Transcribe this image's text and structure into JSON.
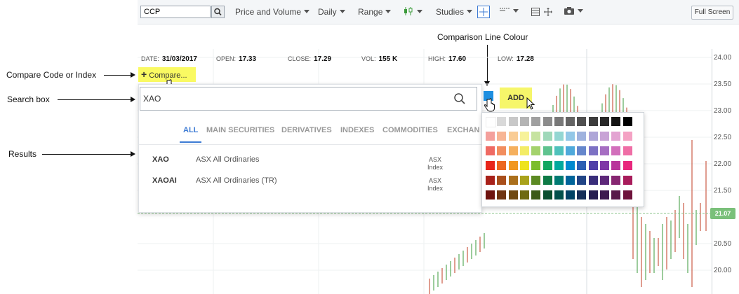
{
  "annotations": {
    "compare": "Compare Code or Index",
    "search": "Search box",
    "results": "Results",
    "colour": "Comparison Line Colour"
  },
  "toolbar": {
    "code_value": "CCP",
    "price_volume": "Price and Volume",
    "interval": "Daily",
    "range": "Range",
    "studies": "Studies",
    "fullscreen": "Full Screen"
  },
  "ohlc": {
    "date_label": "DATE:",
    "date": "31/03/2017",
    "open_label": "OPEN:",
    "open": "17.33",
    "close_label": "CLOSE:",
    "close": "17.29",
    "vol_label": "VOL:",
    "vol": "155 K",
    "high_label": "HIGH:",
    "high": "17.60",
    "low_label": "LOW:",
    "low": "17.28"
  },
  "compare": {
    "label": "Compare..."
  },
  "search": {
    "value": "XAO",
    "tabs": [
      "ALL",
      "MAIN SECURITIES",
      "DERIVATIVES",
      "INDEXES",
      "COMMODITIES",
      "EXCHAN"
    ],
    "results": [
      {
        "code": "XAO",
        "name": "ASX All Ordinaries",
        "type_line1": "ASX",
        "type_line2": "Index"
      },
      {
        "code": "XAOAI",
        "name": "ASX All Ordinaries (TR)",
        "type_line1": "ASX",
        "type_line2": "Index"
      }
    ]
  },
  "add_button": "ADD",
  "colours": {
    "selected": "#1e8fe0",
    "rows": [
      [
        "#ffffff",
        "#d9d9d9",
        "#c8c8c8",
        "#b4b4b4",
        "#a0a0a0",
        "#8c8c8c",
        "#787878",
        "#646464",
        "#505050",
        "#3c3c3c",
        "#282828",
        "#141414",
        "#000000"
      ],
      [
        "#f4a09c",
        "#f7b595",
        "#f9cc95",
        "#f7f29a",
        "#c6e3a0",
        "#9fd8b9",
        "#93d6d2",
        "#93c7e7",
        "#9fb2de",
        "#aea6d8",
        "#c8a3d6",
        "#e3a3d2",
        "#f4a2c4"
      ],
      [
        "#ef6a63",
        "#f28e5f",
        "#f5b05e",
        "#f3ec66",
        "#a4d26c",
        "#5fc38f",
        "#4fc1bb",
        "#4fa9db",
        "#6687cc",
        "#7d72c4",
        "#a66ec2",
        "#d26fbb",
        "#ef6ea6"
      ],
      [
        "#e8261b",
        "#ec6720",
        "#f19721",
        "#eee31e",
        "#7cbd2d",
        "#13a760",
        "#00a99d",
        "#0089cf",
        "#2d5fb4",
        "#4f3fa8",
        "#7f38a7",
        "#b8369b",
        "#e8267d"
      ],
      [
        "#a8211a",
        "#a94f1c",
        "#ab701c",
        "#a9a21b",
        "#5c8a23",
        "#0e7a46",
        "#007a72",
        "#00649a",
        "#214586",
        "#392e7b",
        "#5d287a",
        "#862671",
        "#a81c5b"
      ],
      [
        "#6e1410",
        "#6f3412",
        "#704913",
        "#6f6a12",
        "#3c5a17",
        "#094f2e",
        "#00504b",
        "#004265",
        "#162e58",
        "#261e51",
        "#3d1a50",
        "#58194a",
        "#6e123b"
      ]
    ]
  },
  "axis": {
    "ticks": [
      "24.00",
      "23.50",
      "23.00",
      "22.50",
      "22.00",
      "21.50",
      "21.07",
      "20.50",
      "20.00"
    ],
    "last_price": "21.07"
  }
}
